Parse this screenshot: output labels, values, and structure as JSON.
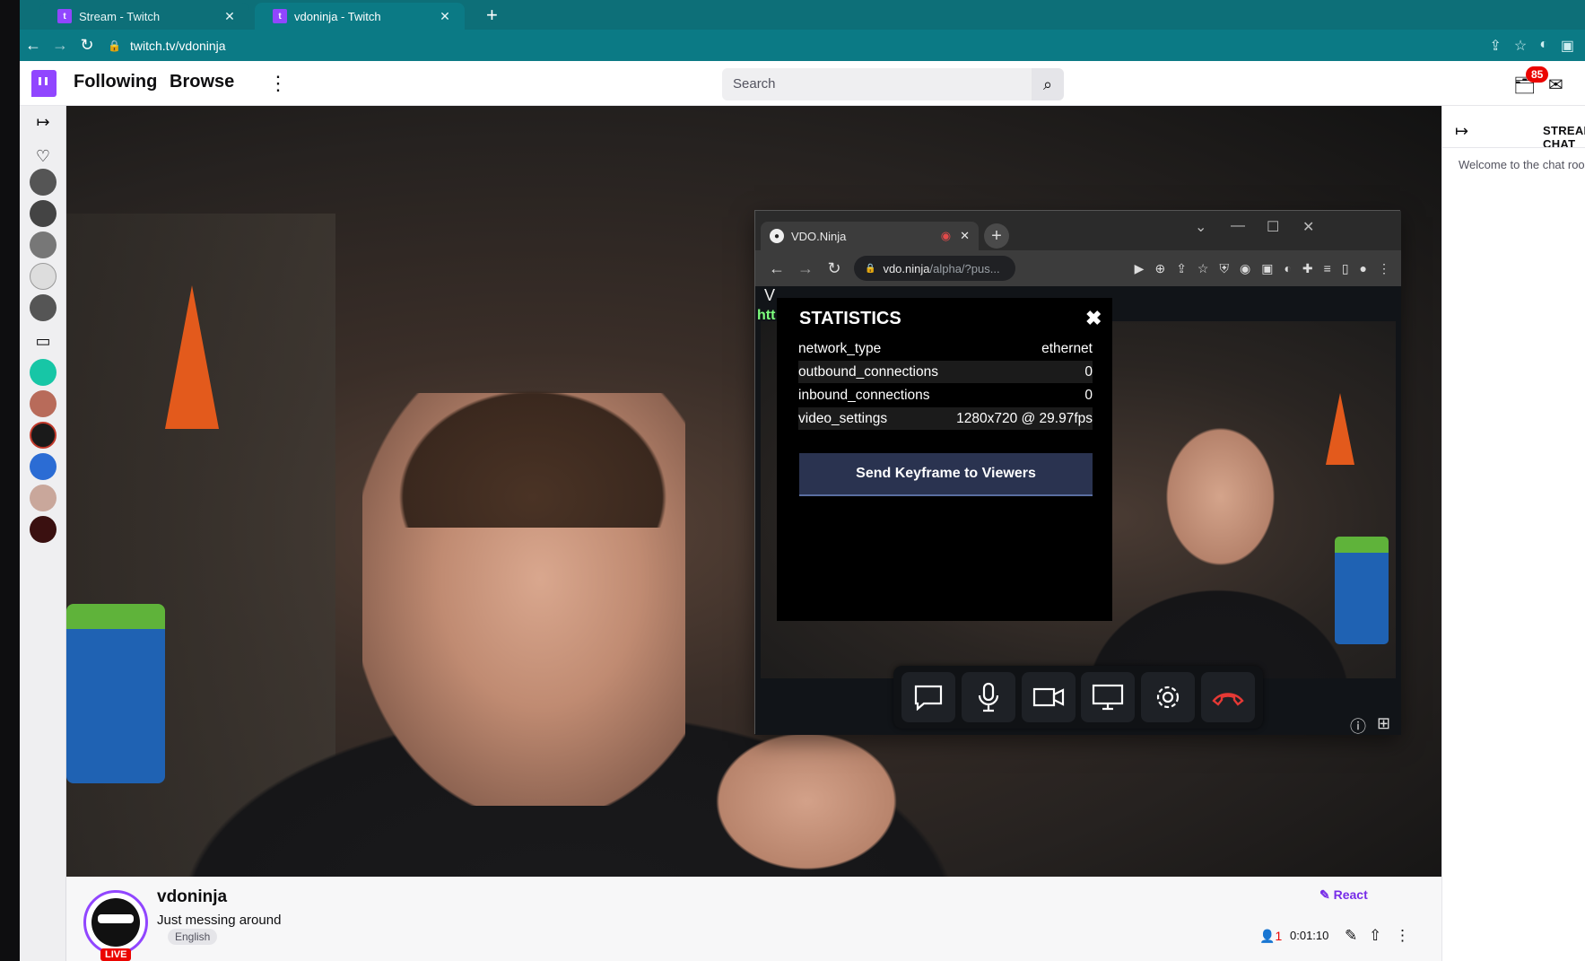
{
  "browser": {
    "tabs": [
      {
        "label": "Stream - Twitch",
        "active": false
      },
      {
        "label": "vdoninja - Twitch",
        "active": true
      }
    ],
    "url": "twitch.tv/vdoninja",
    "accent": "#0b7a85"
  },
  "twitch": {
    "nav": {
      "following": "Following",
      "browse": "Browse",
      "search_placeholder": "Search",
      "notification_count": "85"
    },
    "chat": {
      "header": "STREAM CHAT",
      "welcome": "Welcome to the chat room!"
    },
    "channel": {
      "name": "vdoninja",
      "title": "Just messing around",
      "tag": "English",
      "live_label": "LIVE",
      "react": "React",
      "viewers": "1",
      "uptime": "0:01:10"
    },
    "brand_color": "#9146ff"
  },
  "vdo_window": {
    "tab_label": "VDO.Ninja",
    "url_host": "vdo.ninja",
    "url_rest": "/alpha/?pus...",
    "page_text": "V",
    "page_link": "htt"
  },
  "stats": {
    "title": "STATISTICS",
    "rows": [
      {
        "key": "network_type",
        "value": "ethernet"
      },
      {
        "key": "outbound_connections",
        "value": "0"
      },
      {
        "key": "inbound_connections",
        "value": "0"
      },
      {
        "key": "video_settings",
        "value": "1280x720 @ 29.97fps"
      }
    ],
    "keyframe_button": "Send Keyframe to Viewers"
  },
  "controls": [
    "chat-icon",
    "microphone-icon",
    "camera-icon",
    "screen-share-icon",
    "settings-icon",
    "hang-up-icon"
  ]
}
